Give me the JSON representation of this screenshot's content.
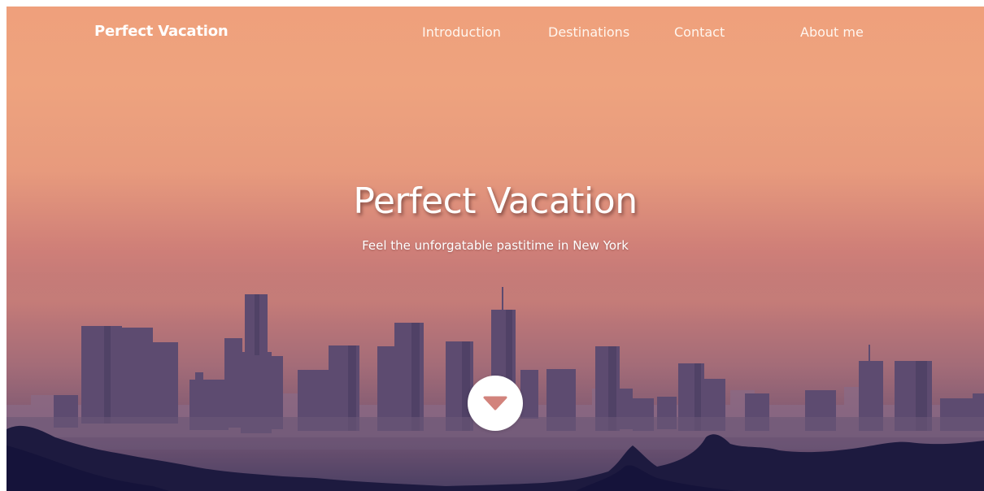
{
  "nav": {
    "brand": "Perfect Vacation",
    "items": [
      {
        "label": "Introduction"
      },
      {
        "label": "Destinations"
      },
      {
        "label": "Contact"
      },
      {
        "label": "About me"
      }
    ]
  },
  "hero": {
    "title": "Perfect Vacation",
    "subtitle": "Feel the unforgatable pastitime in New York",
    "scroll_icon": "caret-down-icon",
    "background": "city-skyline-at-sunset"
  },
  "colors": {
    "sky_top": "#efa07c",
    "sky_bottom": "#4a3f63",
    "buildings": "#5b4a6e",
    "foreground": "#1d1a3f",
    "caret": "#d2837c"
  }
}
